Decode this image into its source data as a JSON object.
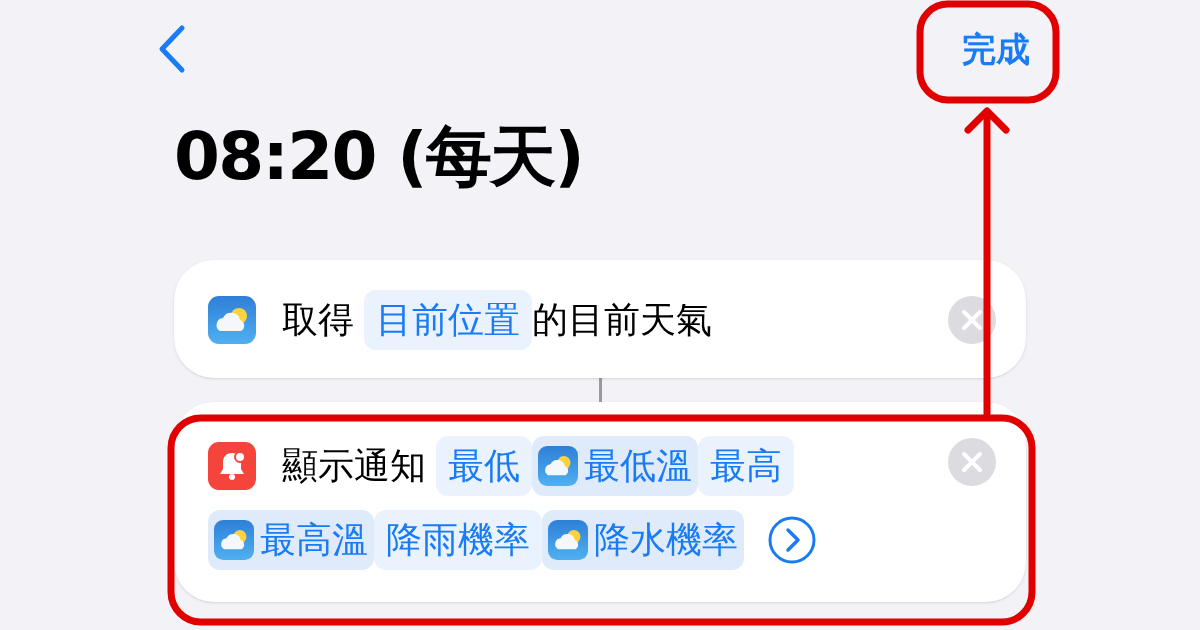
{
  "nav": {
    "done": "完成"
  },
  "title": "08:20 (每天)",
  "actions": [
    {
      "kind": "weather",
      "tokens": [
        {
          "kind": "text",
          "text": "取得"
        },
        {
          "kind": "param",
          "text": "目前位置"
        },
        {
          "kind": "text",
          "text": "的目前天氣"
        }
      ],
      "expandable": false
    },
    {
      "kind": "notification",
      "tokens": [
        {
          "kind": "text",
          "text": "顯示通知"
        },
        {
          "kind": "param",
          "text": "最低"
        },
        {
          "kind": "variable",
          "text": "最低溫"
        },
        {
          "kind": "param",
          "text": "最高"
        },
        {
          "kind": "variable",
          "text": "最高溫"
        },
        {
          "kind": "param",
          "text": "降雨機率"
        },
        {
          "kind": "variable",
          "text": "降水機率"
        }
      ],
      "expandable": true
    }
  ]
}
